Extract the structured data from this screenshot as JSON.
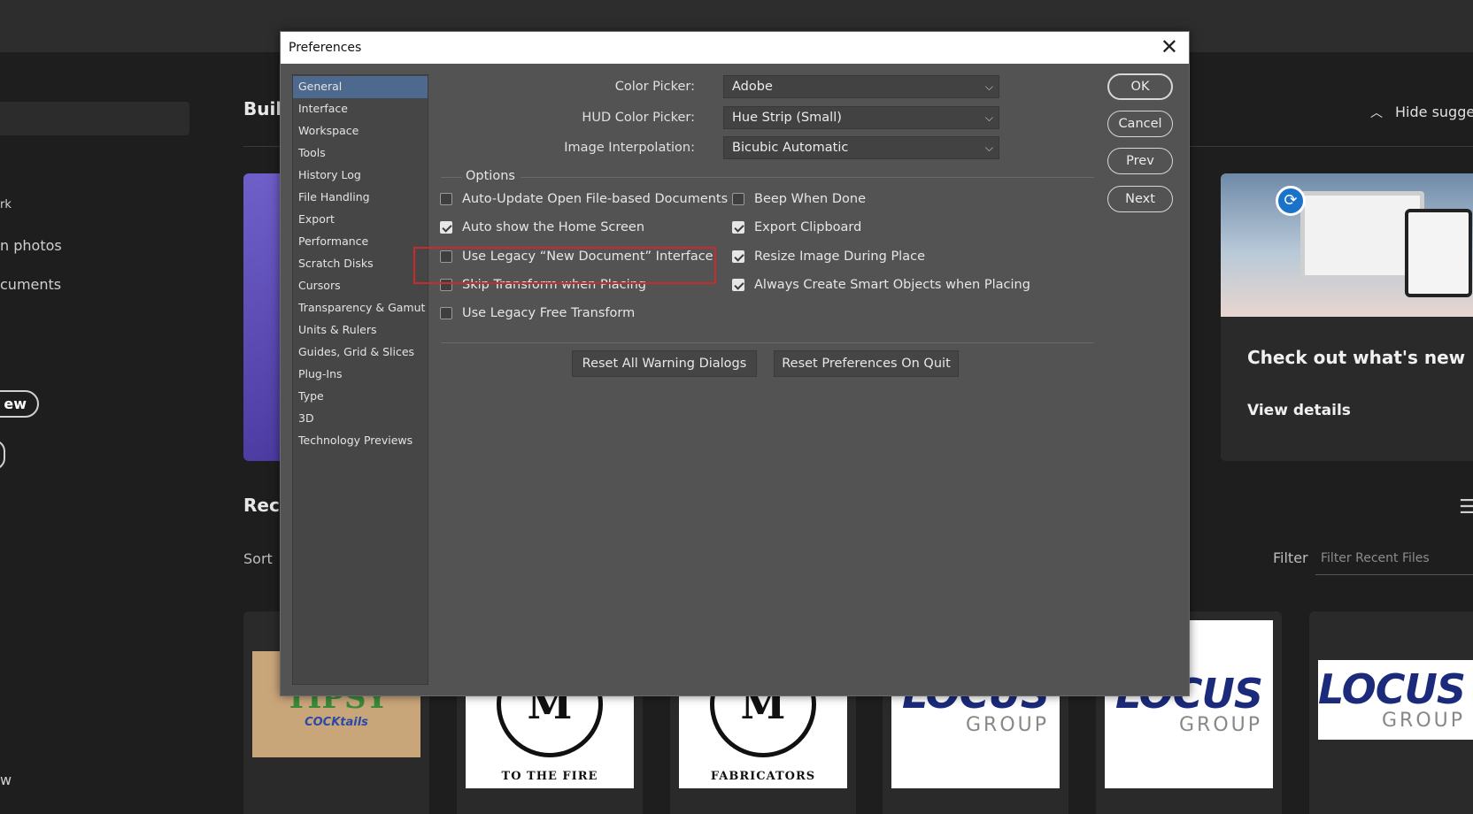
{
  "home": {
    "left_links": [
      "rk",
      "n photos",
      "cuments"
    ],
    "left_buttons": [
      "ew",
      ")"
    ],
    "bottom_left": "w",
    "build_title": "Build",
    "hide_suggestions": "Hide suggestions",
    "recent_title": "Recent",
    "sort_label": "Sort",
    "filter_label": "Filter",
    "filter_placeholder": "Filter Recent Files",
    "whats_new": {
      "title": "Check out what's new",
      "link": "View details"
    },
    "thumbnails": [
      {
        "kind": "tipsy",
        "logo": "TIPSY",
        "sub": "COCKtails"
      },
      {
        "kind": "emblem",
        "mark": "M",
        "caption": "TO THE FIRE"
      },
      {
        "kind": "emblem",
        "mark": "M",
        "caption": "FABRICATORS"
      },
      {
        "kind": "locus",
        "logo": "LOCUS",
        "sub": "GROUP"
      },
      {
        "kind": "locus",
        "logo": "LOCUS",
        "sub": "GROUP"
      },
      {
        "kind": "locus",
        "logo": "LOCUS",
        "sub": "GROUP"
      }
    ]
  },
  "dialog": {
    "title": "Preferences",
    "close_glyph": "✕",
    "categories": [
      "General",
      "Interface",
      "Workspace",
      "Tools",
      "History Log",
      "File Handling",
      "Export",
      "Performance",
      "Scratch Disks",
      "Cursors",
      "Transparency & Gamut",
      "Units & Rulers",
      "Guides, Grid & Slices",
      "Plug-Ins",
      "Type",
      "3D",
      "Technology Previews"
    ],
    "selected_category": "General",
    "fields": [
      {
        "label": "Color Picker:",
        "value": "Adobe"
      },
      {
        "label": "HUD Color Picker:",
        "value": "Hue Strip (Small)"
      },
      {
        "label": "Image Interpolation:",
        "value": "Bicubic Automatic"
      }
    ],
    "options_label": "Options",
    "options_left": [
      {
        "label": "Auto-Update Open File-based Documents",
        "checked": false
      },
      {
        "label": "Auto show the Home Screen",
        "checked": true
      },
      {
        "label": "Use Legacy “New Document” Interface",
        "checked": false
      },
      {
        "label": "Skip Transform when Placing",
        "checked": false
      },
      {
        "label": "Use Legacy Free Transform",
        "checked": false
      }
    ],
    "options_right": [
      {
        "label": "Beep When Done",
        "checked": false
      },
      {
        "label": "Export Clipboard",
        "checked": true
      },
      {
        "label": "Resize Image During Place",
        "checked": true
      },
      {
        "label": "Always Create Smart Objects when Placing",
        "checked": true
      }
    ],
    "reset_warnings": "Reset All Warning Dialogs",
    "reset_prefs": "Reset Preferences On Quit",
    "buttons": {
      "ok": "OK",
      "cancel": "Cancel",
      "prev": "Prev",
      "next": "Next"
    }
  },
  "colors": {
    "selected_category": "#4d6a8e",
    "highlight": "#c92a2a",
    "dialog_bg": "#535353"
  },
  "icons": {
    "chevron": "chevron-down-icon",
    "close": "close-icon",
    "hide": "chevron-up-icon",
    "list": "list-view-icon"
  }
}
